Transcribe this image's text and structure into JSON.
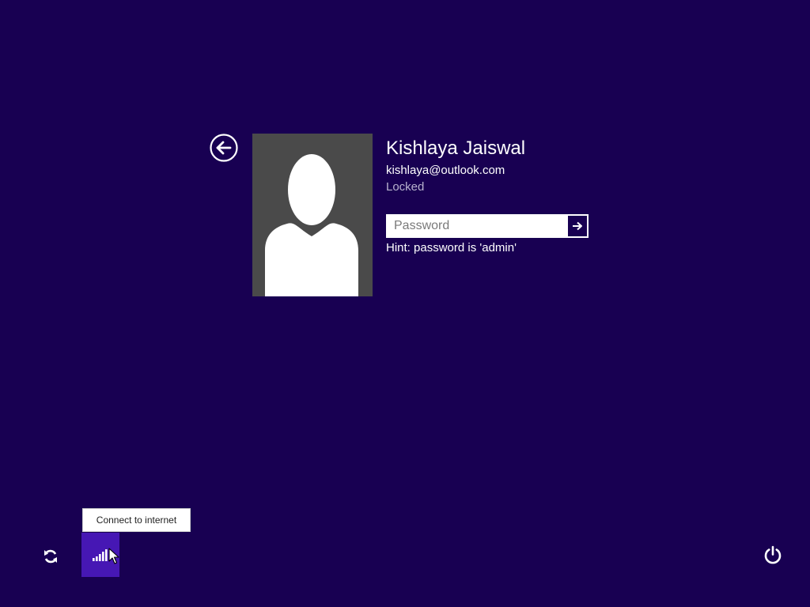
{
  "user": {
    "name": "Kishlaya Jaiswal",
    "email": "kishlaya@outlook.com",
    "status": "Locked"
  },
  "password": {
    "placeholder": "Password",
    "value": "",
    "hint": "Hint: password is 'admin'"
  },
  "bottom_bar": {
    "network_tooltip": "Connect to internet"
  },
  "icons": {
    "back": "back-arrow-icon",
    "submit": "right-arrow-icon",
    "ease_of_access": "ease-of-access-icon",
    "network": "network-signal-icon",
    "power": "power-icon",
    "avatar": "user-silhouette-icon"
  },
  "colors": {
    "background": "#180052",
    "network_button_highlight": "#4617b4",
    "avatar_background": "#4a4a4a",
    "status_text": "#b9b3cf"
  }
}
